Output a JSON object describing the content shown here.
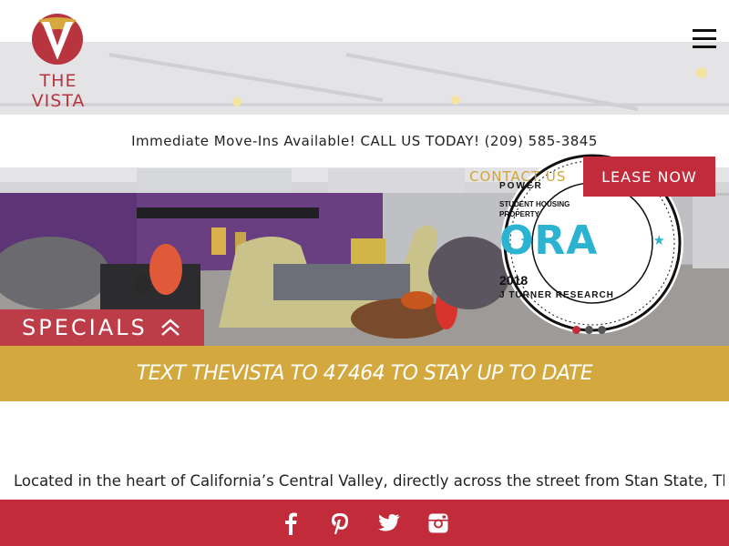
{
  "brand": {
    "name": "THE VISTA"
  },
  "announcement": {
    "text": "Immediate Move-Ins Available! CALL US TODAY!",
    "phone": "(209) 585-3845"
  },
  "nav": {
    "contact_label": "CONTACT US",
    "lease_label": "LEASE NOW",
    "menu_icon": "hamburger-menu-icon"
  },
  "badge": {
    "top_text": "POWER",
    "line1": "STUDENT HOUSING",
    "line2": "PROPERTY",
    "logo_text": "ORA",
    "year": "2018",
    "bottom_text": "J TURNER RESEARCH"
  },
  "slider": {
    "slide_count": 3,
    "active_index": 0
  },
  "specials": {
    "label": "SPECIALS",
    "icon": "double-chevron-up-icon"
  },
  "text_banner": {
    "text": "TEXT THEVISTA TO 47464 TO STAY UP TO DATE"
  },
  "intro": {
    "text": "Located in the heart of California’s Central Valley, directly across the street from Stan State, The"
  },
  "social": [
    {
      "name": "facebook",
      "icon": "facebook-icon"
    },
    {
      "name": "pinterest",
      "icon": "pinterest-icon"
    },
    {
      "name": "twitter",
      "icon": "twitter-icon"
    },
    {
      "name": "instagram",
      "icon": "instagram-icon"
    }
  ],
  "colors": {
    "brand_red": "#c12b3a",
    "gold": "#d3a93f",
    "contact_gold": "#cfa53c",
    "badge_blue": "#2cb3d1"
  }
}
